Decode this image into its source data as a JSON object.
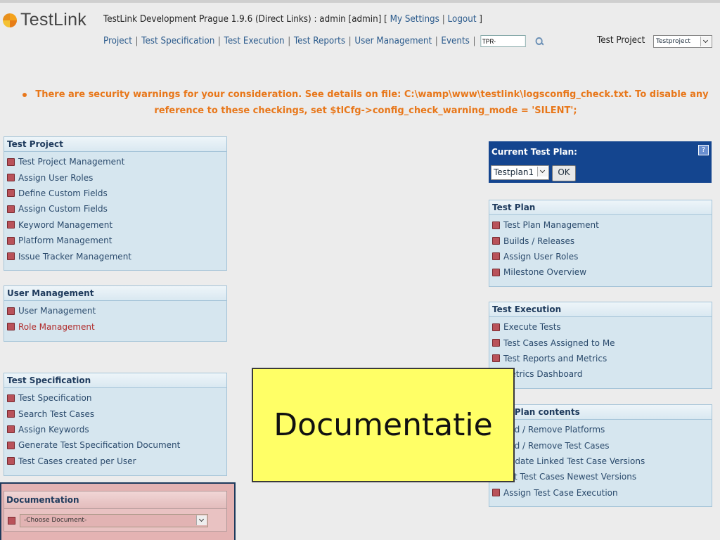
{
  "header": {
    "logo_text": "TestLink",
    "title_main": "TestLink Development Prague 1.9.6 (Direct Links) : admin [admin] [ ",
    "my_settings": "My Settings",
    "separator": "|",
    "logout": "Logout",
    "title_close": " ]",
    "menu": [
      "Project",
      "Test Specification",
      "Test Execution",
      "Test Reports",
      "User Management",
      "Events"
    ],
    "tc_input_value": "TPR-",
    "test_project_label": "Test Project",
    "test_project_value": "Testproject"
  },
  "warning": {
    "text": "There are security warnings for your consideration. See details on file: C:\\wamp\\www\\testlink\\logsconfig_check.txt. To disable any reference to these checkings, set $tlCfg->config_check_warning_mode = 'SILENT';"
  },
  "panels": {
    "test_project": {
      "title": "Test Project",
      "items": [
        "Test Project Management",
        "Assign User Roles",
        "Define Custom Fields",
        "Assign Custom Fields",
        "Keyword Management",
        "Platform Management",
        "Issue Tracker Management"
      ]
    },
    "user_management": {
      "title": "User Management",
      "items": [
        "User Management",
        "Role Management"
      ]
    },
    "test_specification": {
      "title": "Test Specification",
      "items": [
        "Test Specification",
        "Search Test Cases",
        "Assign Keywords",
        "Generate Test Specification Document",
        "Test Cases created per User"
      ]
    },
    "documentation": {
      "title": "Documentation",
      "select_value": "-Choose Document-"
    },
    "current_plan": {
      "title": "Current Test Plan:",
      "help": "?",
      "select_value": "Testplan1",
      "ok": "OK"
    },
    "test_plan": {
      "title": "Test Plan",
      "items": [
        "Test Plan Management",
        "Builds / Releases",
        "Assign User Roles",
        "Milestone Overview"
      ]
    },
    "test_execution": {
      "title": "Test Execution",
      "items": [
        "Execute Tests",
        "Test Cases Assigned to Me",
        "Test Reports and Metrics",
        "Metrics Dashboard"
      ]
    },
    "plan_contents": {
      "title": "Test Plan contents",
      "items": [
        "Add / Remove Platforms",
        "Add / Remove Test Cases",
        "Update Linked Test Case Versions",
        "Set Test Cases Newest Versions",
        "Assign Test Case Execution"
      ]
    }
  },
  "callout": {
    "text": "Documentatie"
  },
  "colors": {
    "accent_blue": "#14458f",
    "warning_orange": "#e8771a",
    "callout_yellow": "#ffff66"
  }
}
